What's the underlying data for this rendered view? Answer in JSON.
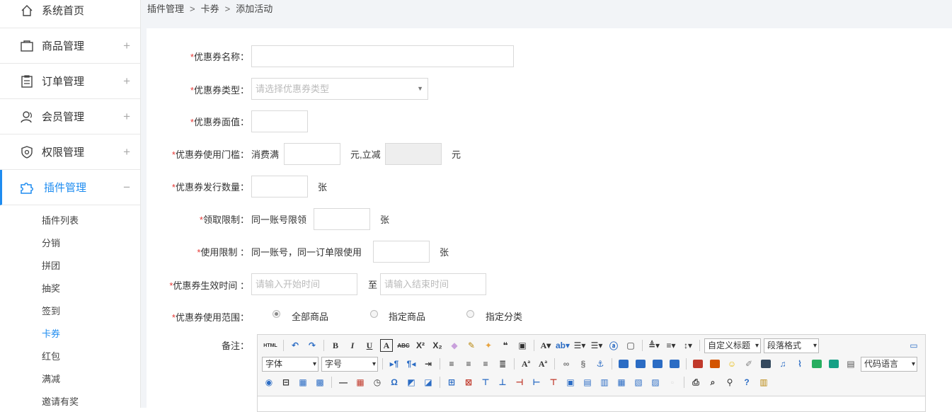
{
  "sidebar": {
    "menu": [
      {
        "label": "系统首页",
        "icon": "home-icon",
        "expandable": false
      },
      {
        "label": "商品管理",
        "icon": "box-icon",
        "expandable": true,
        "toggle": "+"
      },
      {
        "label": "订单管理",
        "icon": "clipboard-icon",
        "expandable": true,
        "toggle": "+"
      },
      {
        "label": "会员管理",
        "icon": "user-icon",
        "expandable": true,
        "toggle": "+"
      },
      {
        "label": "权限管理",
        "icon": "shield-icon",
        "expandable": true,
        "toggle": "+"
      },
      {
        "label": "插件管理",
        "icon": "puzzle-icon",
        "expandable": true,
        "toggle": "−",
        "active": true
      }
    ],
    "submenu": [
      "插件列表",
      "分销",
      "拼团",
      "抽奖",
      "签到",
      "卡券",
      "红包",
      "满减",
      "邀请有奖"
    ],
    "active_sub": "卡券",
    "accent": "#1e8cf0"
  },
  "breadcrumb": {
    "items": [
      "插件管理",
      "卡券",
      "添加活动"
    ],
    "sep": ">"
  },
  "form": {
    "name_label": "优惠券名称：",
    "type_label": "优惠券类型：",
    "type_placeholder": "请选择优惠券类型",
    "value_label": "优惠券面值：",
    "threshold_label": "优惠券使用门槛：",
    "threshold_prefix": "消费满",
    "threshold_mid": "元,立减",
    "threshold_suffix": "元",
    "count_label": "优惠券发行数量：",
    "count_unit": "张",
    "receive_label": "领取限制：",
    "receive_prefix": "同一账号限领",
    "receive_unit": "张",
    "use_label": "使用限制 ：",
    "use_prefix": "同一账号，同一订单限使用",
    "use_unit": "张",
    "time_label": "优惠券生效时间 ：",
    "start_placeholder": "请输入开始时间",
    "time_to": "至",
    "end_placeholder": "请输入结束时间",
    "scope_label": "优惠券使用范围：",
    "scope_options": [
      "全部商品",
      "指定商品",
      "指定分类"
    ],
    "scope_selected": "全部商品",
    "remark_label": "备注：",
    "required_mark": "*"
  },
  "editor": {
    "html_btn": "HTML",
    "custom_title": "自定义标题",
    "paragraph": "段落格式",
    "font": "字体",
    "size": "字号",
    "code_lang": "代码语言"
  }
}
